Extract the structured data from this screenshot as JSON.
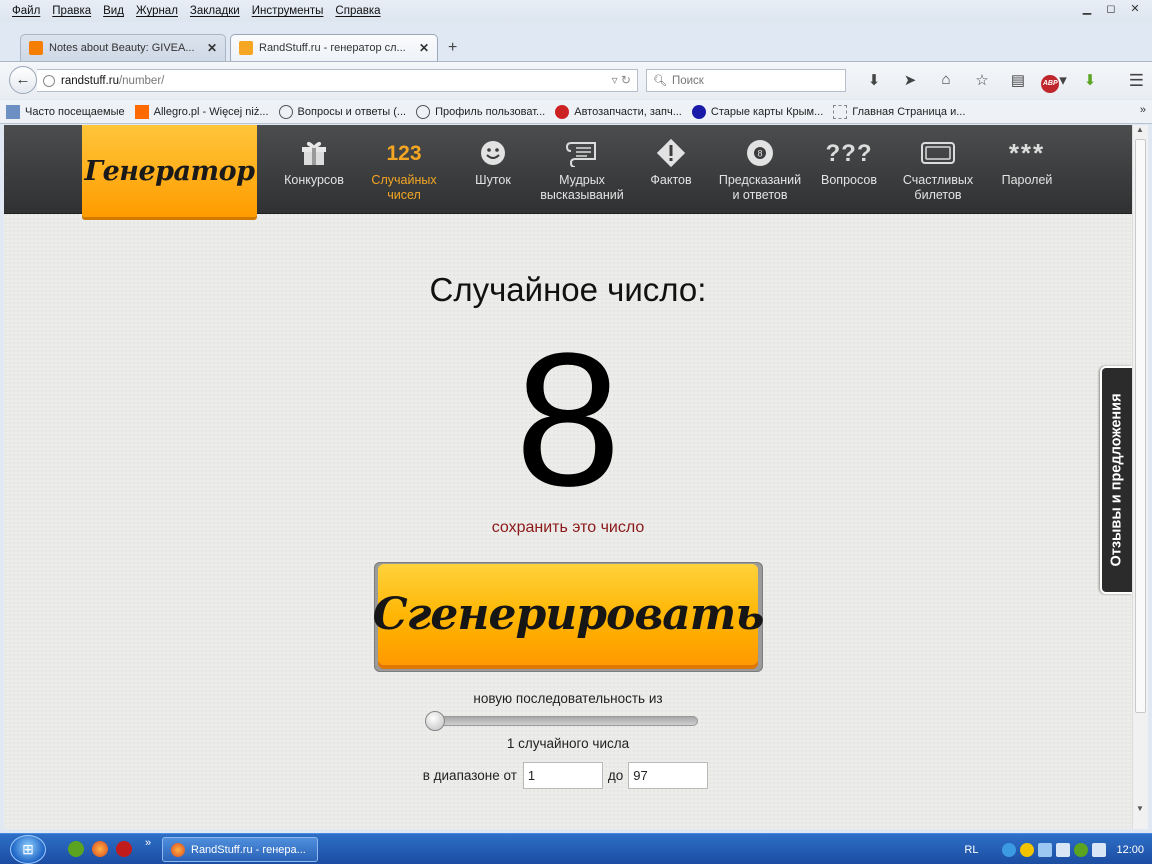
{
  "browser": {
    "menu": [
      "Файл",
      "Правка",
      "Вид",
      "Журнал",
      "Закладки",
      "Инструменты",
      "Справка"
    ],
    "tabs": [
      {
        "title": "Notes about Beauty: GIVEA...",
        "close": "✕"
      },
      {
        "title": "RandStuff.ru - генератор сл...",
        "close": "✕"
      }
    ],
    "new_tab": "+",
    "url": {
      "host": "randstuff.ru",
      "path": "/number/"
    },
    "search_placeholder": "Поиск",
    "abp_label": "ABP",
    "bookmarks": [
      "Часто посещаемые",
      "Allegro.pl - Więcej niż...",
      "Вопросы и ответы (...",
      "Профиль пользоват...",
      "Автозапчасти, запч...",
      "Старые карты Крым...",
      "Главная Страница и..."
    ],
    "bookmarks_more": "»"
  },
  "site": {
    "logo": "Генератор",
    "nav": [
      {
        "icon": "gift-icon",
        "label": "Конкурсов",
        "active": false
      },
      {
        "icon": "numbers-icon",
        "icon_text": "123",
        "label": "Случайных чисел",
        "active": true
      },
      {
        "icon": "smiley-icon",
        "label": "Шуток",
        "active": false
      },
      {
        "icon": "scroll-icon",
        "label": "Мудрых высказываний",
        "active": false
      },
      {
        "icon": "warning-icon",
        "label": "Фактов",
        "active": false
      },
      {
        "icon": "eight-ball-icon",
        "label": "Предсказаний и ответов",
        "active": false
      },
      {
        "icon": "question-marks-icon",
        "icon_text": "???",
        "label": "Вопросов",
        "active": false
      },
      {
        "icon": "ticket-icon",
        "label": "Счастливых билетов",
        "active": false
      },
      {
        "icon": "asterisks-icon",
        "icon_text": "***",
        "label": "Паролей",
        "active": false
      }
    ],
    "headline": "Случайное число:",
    "result": "8",
    "save_link": "сохранить это число",
    "generate_button": "Сгенерировать",
    "sequence_label": "новую последовательность из",
    "slider_value": 1,
    "count_label": "1 случайного числа",
    "range": {
      "from_label": "в диапазоне от",
      "from": "1",
      "to_label": "до",
      "to": "97"
    },
    "feedback_tab": "Отзывы и предложения"
  },
  "taskbar": {
    "window_title": "RandStuff.ru - генера...",
    "lang": "RL",
    "clock": "12:00"
  },
  "colors": {
    "accent": "#ff9c00",
    "nav_active": "#f5a623",
    "save_link": "#8b1a1a",
    "nav_bg": "#3a3c3d"
  }
}
